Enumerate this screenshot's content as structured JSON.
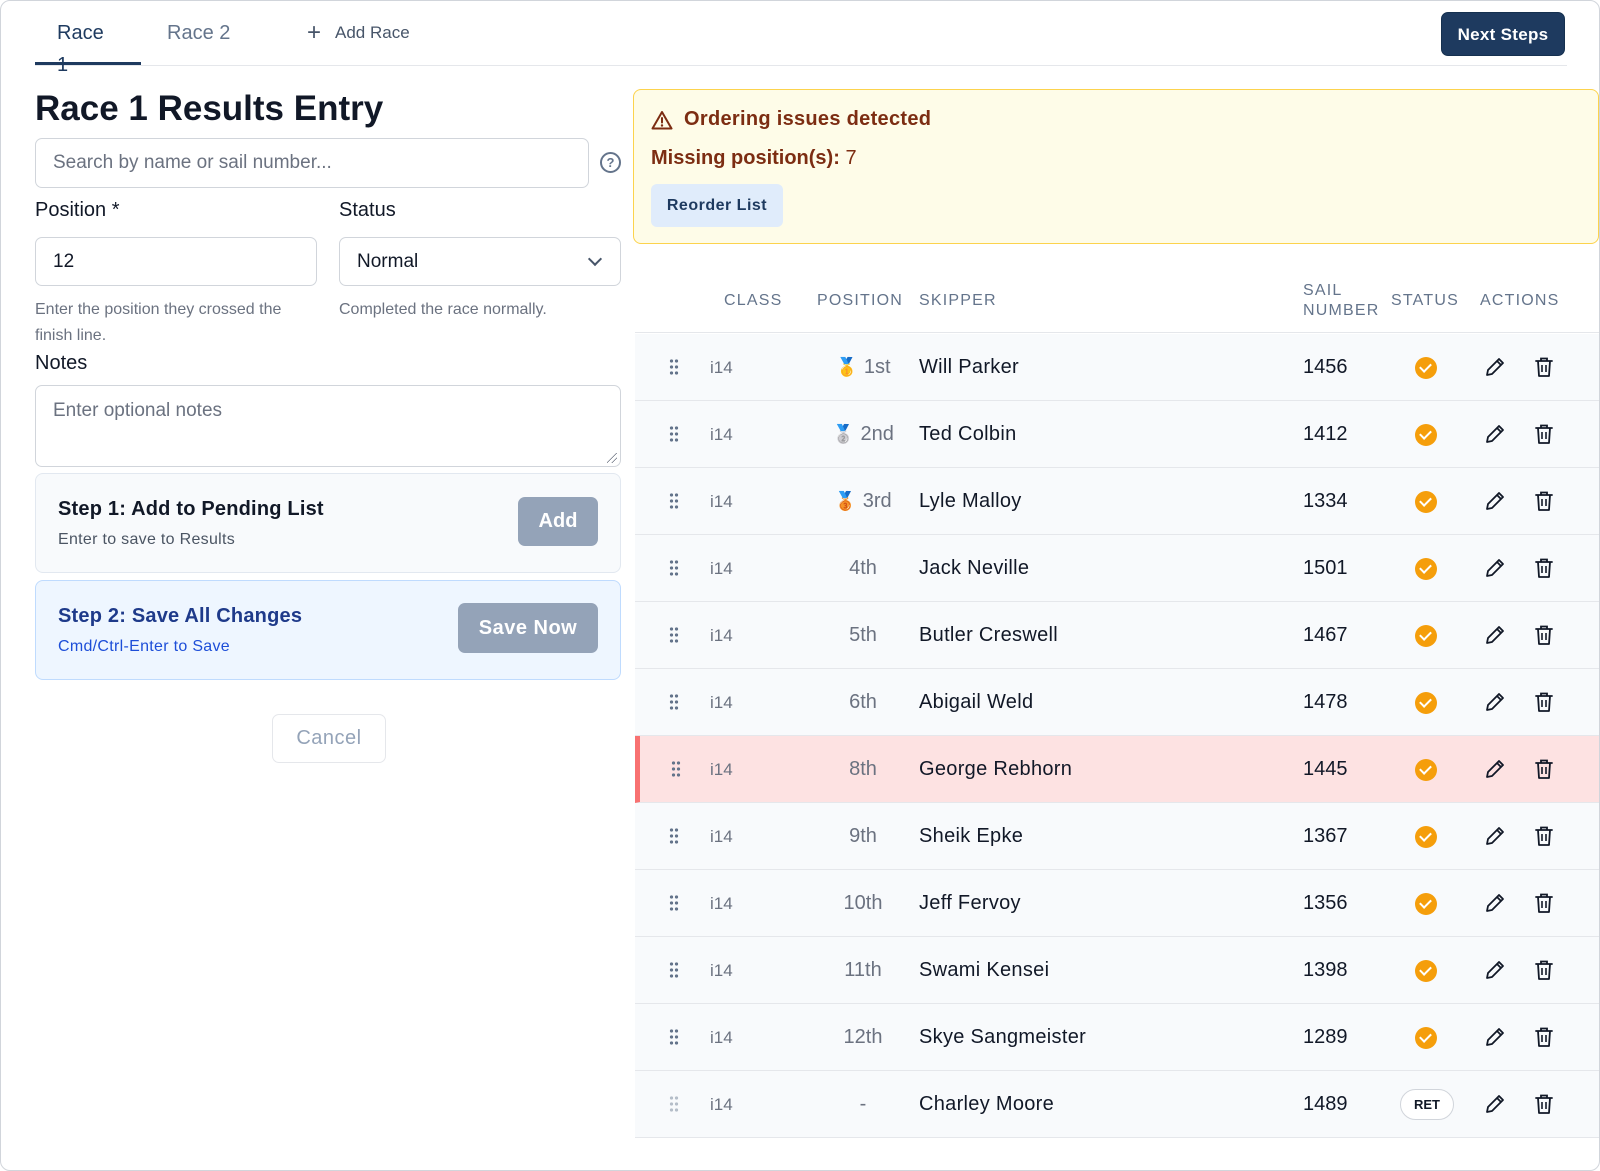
{
  "tabs": [
    {
      "label": "Race 1",
      "active": true
    },
    {
      "label": "Race 2",
      "active": false
    }
  ],
  "add_race_label": "Add Race",
  "next_steps_label": "Next Steps",
  "form": {
    "title": "Race 1 Results Entry",
    "search_placeholder": "Search by name or sail number...",
    "position_label": "Position *",
    "position_value": "12",
    "position_hint": "Enter the position they crossed the finish line.",
    "status_label": "Status",
    "status_value": "Normal",
    "status_hint": "Completed the race normally.",
    "notes_label": "Notes",
    "notes_placeholder": "Enter optional notes",
    "step1_title": "Step 1: Add to Pending List",
    "step1_sub": "Enter to save to Results",
    "add_label": "Add",
    "step2_title": "Step 2: Save All Changes",
    "step2_sub": "Cmd/Ctrl-Enter to Save",
    "save_label": "Save Now",
    "cancel_label": "Cancel"
  },
  "warning": {
    "title": "Ordering issues detected",
    "missing_label": "Missing position(s):",
    "missing_value": "7",
    "reorder_label": "Reorder List"
  },
  "table": {
    "headers": {
      "class": "CLASS",
      "position": "POSITION",
      "skipper": "SKIPPER",
      "sail": "SAIL NUMBER",
      "status": "STATUS",
      "actions": "ACTIONS"
    },
    "rows": [
      {
        "class": "i14",
        "medal": "🥇",
        "position": "1st",
        "skipper": "Will Parker",
        "sail": "1456",
        "status": "ok"
      },
      {
        "class": "i14",
        "medal": "🥈",
        "position": "2nd",
        "skipper": "Ted Colbin",
        "sail": "1412",
        "status": "ok"
      },
      {
        "class": "i14",
        "medal": "🥉",
        "position": "3rd",
        "skipper": "Lyle Malloy",
        "sail": "1334",
        "status": "ok"
      },
      {
        "class": "i14",
        "medal": "",
        "position": "4th",
        "skipper": "Jack Neville",
        "sail": "1501",
        "status": "ok"
      },
      {
        "class": "i14",
        "medal": "",
        "position": "5th",
        "skipper": "Butler Creswell",
        "sail": "1467",
        "status": "ok"
      },
      {
        "class": "i14",
        "medal": "",
        "position": "6th",
        "skipper": "Abigail Weld",
        "sail": "1478",
        "status": "ok"
      },
      {
        "class": "i14",
        "medal": "",
        "position": "8th",
        "skipper": "George Rebhorn",
        "sail": "1445",
        "status": "ok",
        "flag": true
      },
      {
        "class": "i14",
        "medal": "",
        "position": "9th",
        "skipper": "Sheik Epke",
        "sail": "1367",
        "status": "ok"
      },
      {
        "class": "i14",
        "medal": "",
        "position": "10th",
        "skipper": "Jeff Fervoy",
        "sail": "1356",
        "status": "ok"
      },
      {
        "class": "i14",
        "medal": "",
        "position": "11th",
        "skipper": "Swami Kensei",
        "sail": "1398",
        "status": "ok"
      },
      {
        "class": "i14",
        "medal": "",
        "position": "12th",
        "skipper": "Skye Sangmeister",
        "sail": "1289",
        "status": "ok"
      },
      {
        "class": "i14",
        "medal": "",
        "position": "-",
        "skipper": "Charley Moore",
        "sail": "1489",
        "status": "RET",
        "dim": true
      }
    ]
  },
  "colors": {
    "primary": "#1e3a5f",
    "warning_bg": "#fefce8",
    "warning_text": "#7c2d12",
    "status_ok": "#f59e0b",
    "flag_row": "#fde2e2",
    "flag_bar": "#f87171"
  }
}
